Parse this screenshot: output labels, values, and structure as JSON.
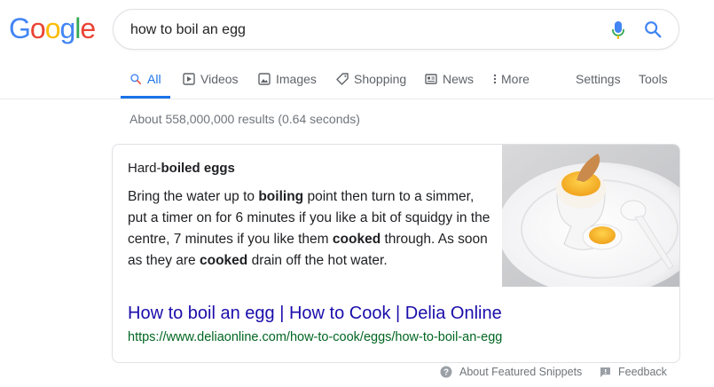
{
  "logo": {
    "letters": [
      {
        "char": "G",
        "color": "#4285F4"
      },
      {
        "char": "o",
        "color": "#EA4335"
      },
      {
        "char": "o",
        "color": "#FBBC05"
      },
      {
        "char": "g",
        "color": "#4285F4"
      },
      {
        "char": "l",
        "color": "#34A853"
      },
      {
        "char": "e",
        "color": "#EA4335"
      }
    ]
  },
  "search": {
    "query": "how to boil an egg",
    "mic_icon": "microphone-icon",
    "search_icon": "magnifier-icon"
  },
  "tabs": {
    "all": "All",
    "videos": "Videos",
    "images": "Images",
    "shopping": "Shopping",
    "news": "News",
    "more": "More",
    "settings": "Settings",
    "tools": "Tools",
    "active_color": "#1a73e8"
  },
  "stats": "About 558,000,000 results (0.64 seconds)",
  "snippet": {
    "title_plain": "Hard-",
    "title_bold": "boiled eggs",
    "body": [
      {
        "t": "Bring the water up to ",
        "b": false
      },
      {
        "t": "boiling",
        "b": true
      },
      {
        "t": " point then turn to a simmer, put a timer on for 6 minutes if you like a bit of squidgy in the centre, 7 minutes if you like them ",
        "b": false
      },
      {
        "t": "cooked",
        "b": true
      },
      {
        "t": " through. As soon as they are ",
        "b": false
      },
      {
        "t": "cooked",
        "b": true
      },
      {
        "t": " drain off the hot water.",
        "b": false
      }
    ],
    "image_icon": "boiled-egg-image",
    "link_title": "How to boil an egg | How to Cook | Delia Online",
    "url": "https://www.deliaonline.com/how-to-cook/eggs/how-to-boil-an-egg",
    "link_color": "#1a0dab",
    "url_color": "#006621"
  },
  "footer": {
    "about": "About Featured Snippets",
    "feedback": "Feedback"
  }
}
